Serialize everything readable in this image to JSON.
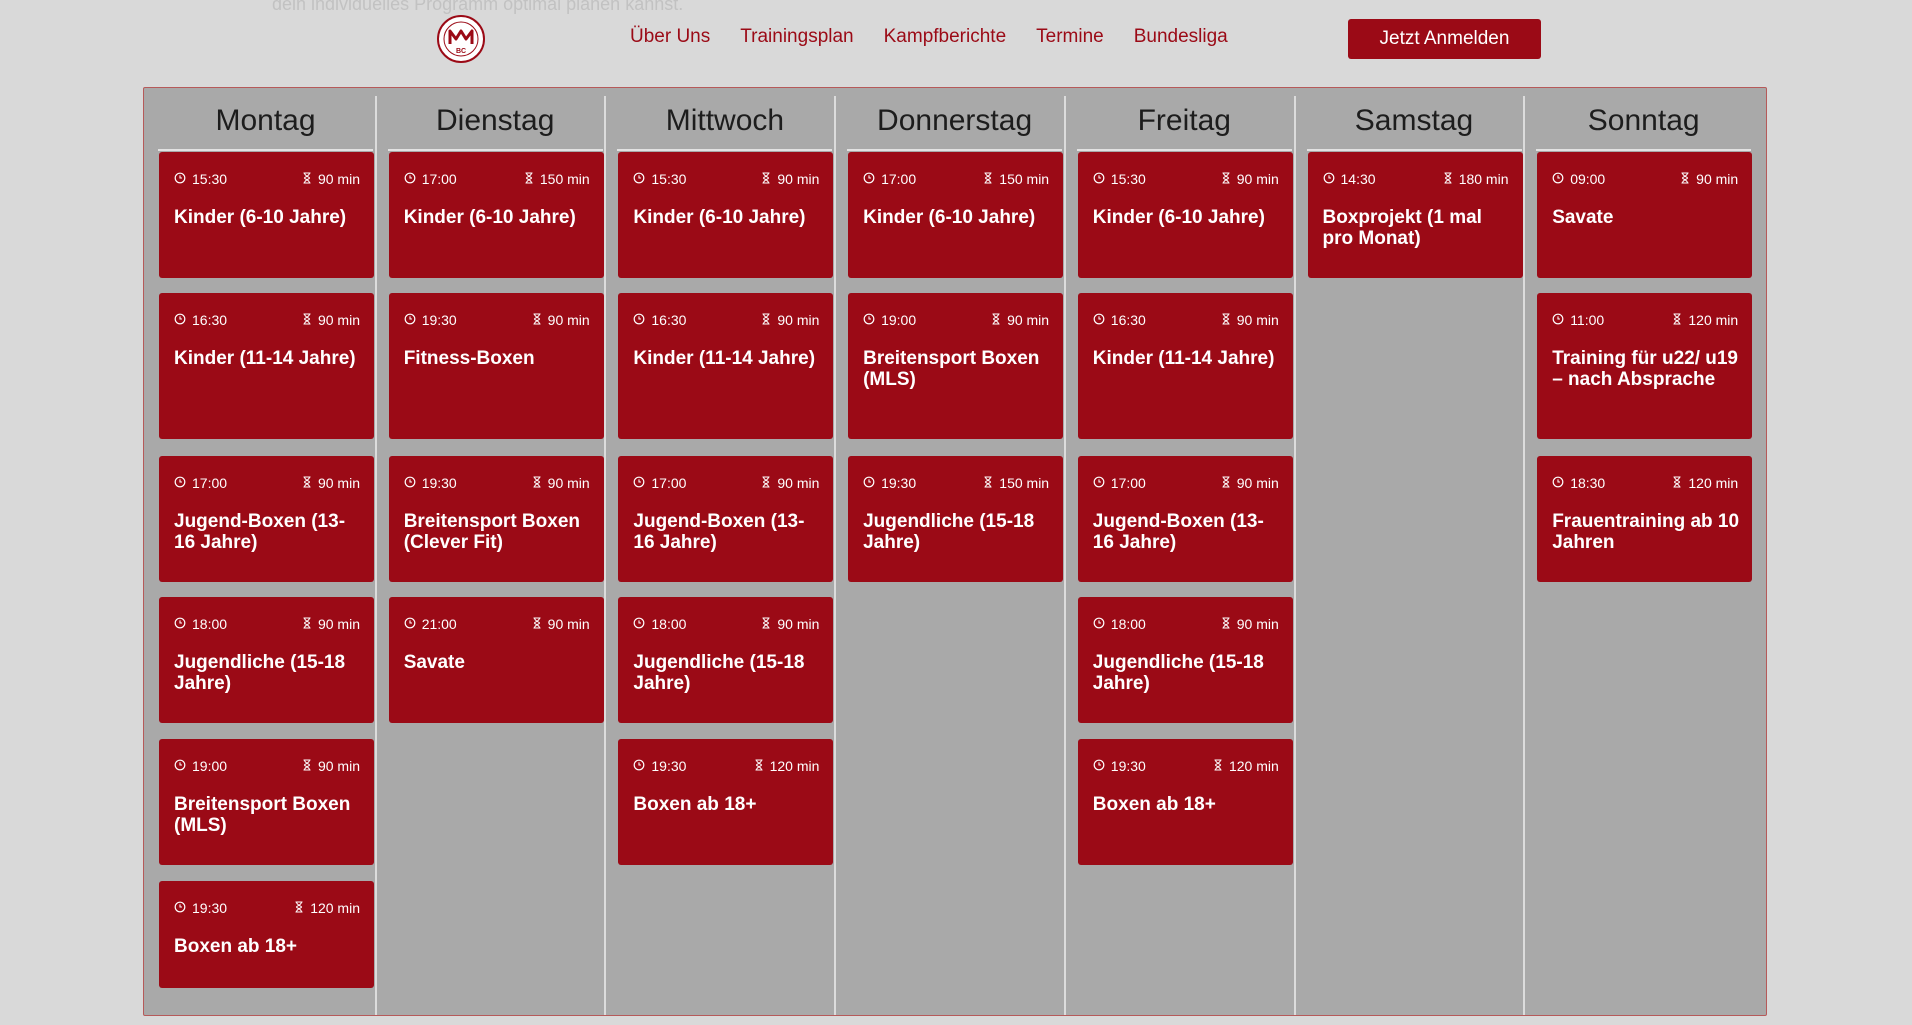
{
  "intro": {
    "text": "dein individuelles Programm optimal planen kannst."
  },
  "brand": {
    "logo_letters": "BC"
  },
  "nav": {
    "items": [
      {
        "label": "Über Uns"
      },
      {
        "label": "Trainingsplan"
      },
      {
        "label": "Kampfberichte"
      },
      {
        "label": "Termine"
      },
      {
        "label": "Bundesliga"
      }
    ],
    "cta_label": "Jetzt Anmelden"
  },
  "colors": {
    "accent": "#9b0a16",
    "panel": "#a9a9a9",
    "page": "#d9d9d9"
  },
  "icons": {
    "time": "clock-icon",
    "duration": "hourglass-icon"
  },
  "schedule": {
    "days": [
      {
        "name": "Montag",
        "sessions": [
          {
            "time": "15:30",
            "duration": "90 min",
            "title": "Kinder (6-10 Jahre)"
          },
          {
            "time": "16:30",
            "duration": "90 min",
            "title": "Kinder (11-14 Jahre)"
          },
          {
            "time": "17:00",
            "duration": "90 min",
            "title": "Jugend-Boxen (13-16 Jahre)"
          },
          {
            "time": "18:00",
            "duration": "90 min",
            "title": "Jugendliche (15-18 Jahre)"
          },
          {
            "time": "19:00",
            "duration": "90 min",
            "title": "Breitensport Boxen (MLS)"
          },
          {
            "time": "19:30",
            "duration": "120 min",
            "title": "Boxen ab 18+"
          }
        ]
      },
      {
        "name": "Dienstag",
        "sessions": [
          {
            "time": "17:00",
            "duration": "150 min",
            "title": "Kinder (6-10 Jahre)"
          },
          {
            "time": "19:30",
            "duration": "90 min",
            "title": "Fitness-Boxen"
          },
          {
            "time": "19:30",
            "duration": "90 min",
            "title": "Breitensport Boxen (Clever Fit)"
          },
          {
            "time": "21:00",
            "duration": "90 min",
            "title": "Savate"
          }
        ]
      },
      {
        "name": "Mittwoch",
        "sessions": [
          {
            "time": "15:30",
            "duration": "90 min",
            "title": "Kinder (6-10 Jahre)"
          },
          {
            "time": "16:30",
            "duration": "90 min",
            "title": "Kinder (11-14 Jahre)"
          },
          {
            "time": "17:00",
            "duration": "90 min",
            "title": "Jugend-Boxen (13-16 Jahre)"
          },
          {
            "time": "18:00",
            "duration": "90 min",
            "title": "Jugendliche (15-18 Jahre)"
          },
          {
            "time": "19:30",
            "duration": "120 min",
            "title": "Boxen ab 18+"
          }
        ]
      },
      {
        "name": "Donnerstag",
        "sessions": [
          {
            "time": "17:00",
            "duration": "150 min",
            "title": "Kinder (6-10 Jahre)"
          },
          {
            "time": "19:00",
            "duration": "90 min",
            "title": "Breitensport Boxen (MLS)"
          },
          {
            "time": "19:30",
            "duration": "150 min",
            "title": "Jugendliche (15-18 Jahre)"
          }
        ]
      },
      {
        "name": "Freitag",
        "sessions": [
          {
            "time": "15:30",
            "duration": "90 min",
            "title": "Kinder (6-10 Jahre)"
          },
          {
            "time": "16:30",
            "duration": "90 min",
            "title": "Kinder (11-14 Jahre)"
          },
          {
            "time": "17:00",
            "duration": "90 min",
            "title": "Jugend-Boxen (13-16 Jahre)"
          },
          {
            "time": "18:00",
            "duration": "90 min",
            "title": "Jugendliche (15-18 Jahre)"
          },
          {
            "time": "19:30",
            "duration": "120 min",
            "title": "Boxen ab 18+"
          }
        ]
      },
      {
        "name": "Samstag",
        "sessions": [
          {
            "time": "14:30",
            "duration": "180 min",
            "title": "Boxprojekt (1 mal pro Monat)"
          }
        ]
      },
      {
        "name": "Sonntag",
        "sessions": [
          {
            "time": "09:00",
            "duration": "90 min",
            "title": "Savate"
          },
          {
            "time": "11:00",
            "duration": "120 min",
            "title": "Training für u22/ u19 – nach Absprache"
          },
          {
            "time": "18:30",
            "duration": "120 min",
            "title": "Frauentraining ab 10 Jahren"
          }
        ]
      }
    ]
  }
}
